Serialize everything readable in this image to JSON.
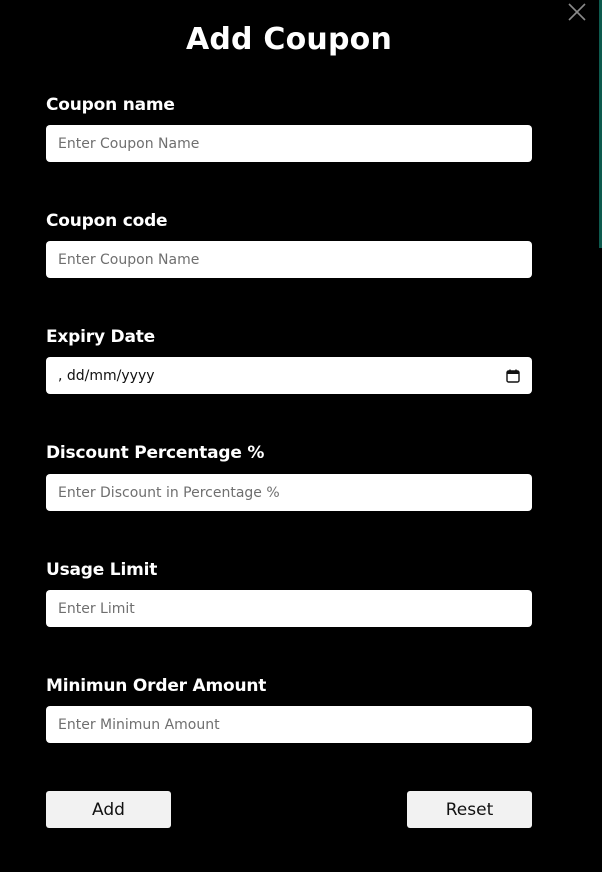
{
  "dialog": {
    "title": "Add Coupon"
  },
  "fields": {
    "coupon_name": {
      "label": "Coupon name",
      "placeholder": "Enter Coupon Name",
      "value": ""
    },
    "coupon_code": {
      "label": "Coupon code",
      "placeholder": "Enter Coupon Name",
      "value": ""
    },
    "expiry_date": {
      "label": "Expiry Date",
      "display_value": ", dd/mm/yyyy",
      "icon": "calendar-icon"
    },
    "discount_percentage": {
      "label": "Discount Percentage %",
      "placeholder": "Enter Discount in Percentage %",
      "value": ""
    },
    "usage_limit": {
      "label": "Usage Limit",
      "placeholder": "Enter Limit",
      "value": ""
    },
    "minimum_order_amount": {
      "label": "Minimun Order Amount",
      "placeholder": "Enter Minimun Amount",
      "value": ""
    }
  },
  "actions": {
    "add_label": "Add",
    "reset_label": "Reset"
  },
  "icons": {
    "close": "close-icon"
  },
  "colors": {
    "background": "#000000",
    "input_background": "#ffffff",
    "button_background": "#f2f2f2",
    "text": "#ffffff"
  }
}
